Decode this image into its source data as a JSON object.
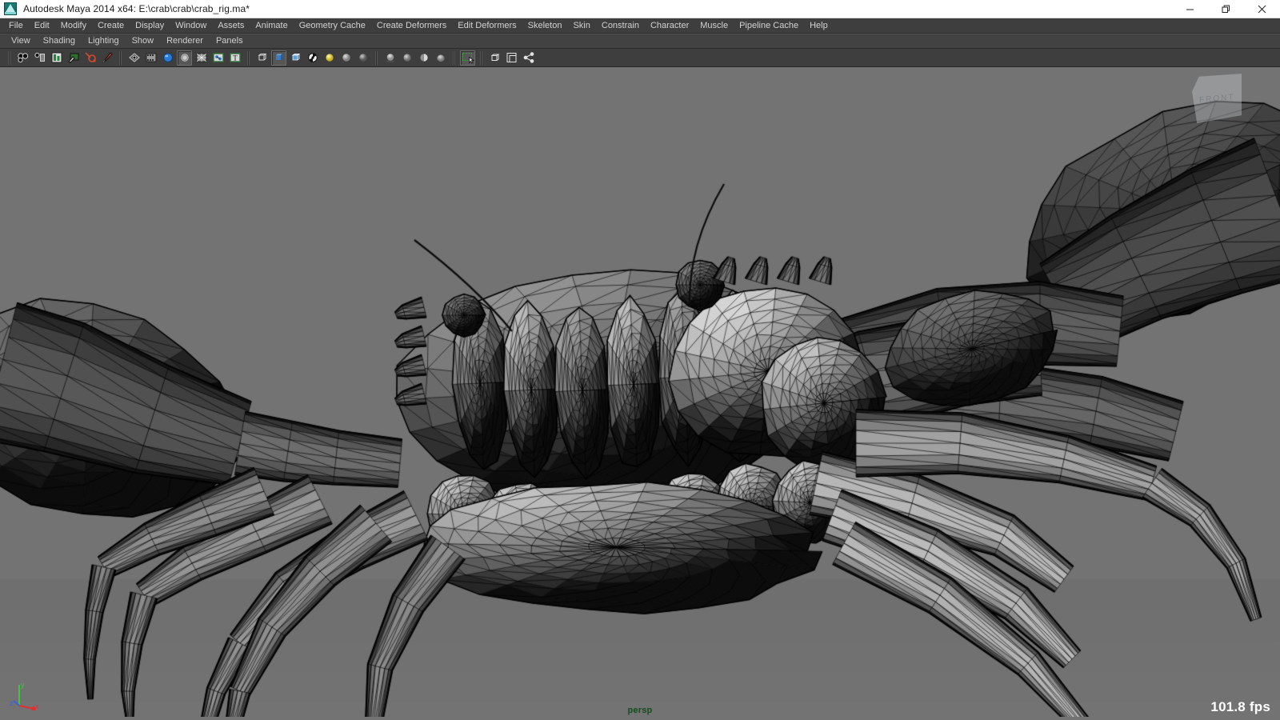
{
  "window": {
    "title": "Autodesk Maya 2014 x64: E:\\crab\\crab\\crab_rig.ma*",
    "app_icon": "maya-logo-icon",
    "controls": [
      {
        "name": "minimize",
        "glyph": "minimize-icon"
      },
      {
        "name": "restore",
        "glyph": "restore-icon"
      },
      {
        "name": "close",
        "glyph": "close-icon"
      }
    ]
  },
  "main_menu": {
    "items": [
      {
        "label": "File"
      },
      {
        "label": "Edit"
      },
      {
        "label": "Modify"
      },
      {
        "label": "Create"
      },
      {
        "label": "Display"
      },
      {
        "label": "Window"
      },
      {
        "label": "Assets"
      },
      {
        "label": "Animate"
      },
      {
        "label": "Geometry Cache"
      },
      {
        "label": "Create Deformers"
      },
      {
        "label": "Edit Deformers"
      },
      {
        "label": "Skeleton"
      },
      {
        "label": "Skin"
      },
      {
        "label": "Constrain"
      },
      {
        "label": "Character"
      },
      {
        "label": "Muscle"
      },
      {
        "label": "Pipeline Cache"
      },
      {
        "label": "Help"
      }
    ]
  },
  "panel_menu": {
    "items": [
      {
        "label": "View"
      },
      {
        "label": "Shading"
      },
      {
        "label": "Lighting"
      },
      {
        "label": "Show"
      },
      {
        "label": "Renderer"
      },
      {
        "label": "Panels"
      }
    ]
  },
  "toolbar": {
    "groups": [
      {
        "name": "selection-masks",
        "buttons": [
          {
            "name": "select-by-hierarchy-icon",
            "pressed": false
          },
          {
            "name": "select-by-object-type-icon",
            "pressed": false
          },
          {
            "name": "select-by-component-type-icon",
            "pressed": false
          },
          {
            "name": "paint-selection-icon",
            "pressed": false
          },
          {
            "name": "snap-to-point-icon",
            "pressed": false
          },
          {
            "name": "paint-brush-icon",
            "pressed": false
          }
        ]
      },
      {
        "name": "display-masks",
        "buttons": [
          {
            "name": "nurbs-surface-mask-icon",
            "pressed": false
          },
          {
            "name": "polygon-mask-icon",
            "pressed": false
          },
          {
            "name": "subdiv-surface-mask-icon",
            "pressed": false
          },
          {
            "name": "deformation-mask-icon",
            "pressed": true
          },
          {
            "name": "dynamics-mask-icon",
            "pressed": false
          },
          {
            "name": "rendering-mask-icon",
            "pressed": false
          },
          {
            "name": "text-mask-icon",
            "pressed": false
          }
        ]
      },
      {
        "name": "shading-modes",
        "buttons": [
          {
            "name": "wireframe-shading-icon",
            "pressed": false
          },
          {
            "name": "smooth-shade-all-icon",
            "pressed": true
          },
          {
            "name": "shaded-wireframe-icon",
            "pressed": false
          },
          {
            "name": "textured-shading-icon",
            "pressed": false
          },
          {
            "name": "use-default-light-icon",
            "pressed": false
          },
          {
            "name": "use-all-lights-icon",
            "pressed": false
          },
          {
            "name": "use-no-lights-icon",
            "pressed": false
          }
        ]
      },
      {
        "name": "lighting-shadows",
        "buttons": [
          {
            "name": "shadow-toggle-icon",
            "pressed": false
          },
          {
            "name": "occlusion-toggle-icon",
            "pressed": false
          },
          {
            "name": "motion-blur-icon",
            "pressed": false
          },
          {
            "name": "anti-alias-icon",
            "pressed": false
          }
        ]
      },
      {
        "name": "isolate-select",
        "buttons": [
          {
            "name": "isolate-select-icon",
            "pressed": true
          }
        ]
      },
      {
        "name": "panel-layout",
        "buttons": [
          {
            "name": "xray-mode-icon",
            "pressed": false
          },
          {
            "name": "xray-joints-icon",
            "pressed": false
          },
          {
            "name": "hypergraph-icon",
            "pressed": false
          }
        ]
      }
    ]
  },
  "viewport": {
    "camera_label": "persp",
    "fps_label": "101.8 fps",
    "background_color": "#737373",
    "viewcube_face": "FRONT",
    "axis_gizmo": {
      "x_label": "x",
      "y_label": "y",
      "z_label": "z",
      "x_color": "#e03030",
      "y_color": "#3fc43f",
      "z_color": "#3b5fe0"
    },
    "scene": {
      "name": "crab_rig",
      "display_mode": "smooth-shade-with-wireframe",
      "mesh_wire_color": "#000000",
      "mesh_fill_light": "#e8e8e8",
      "mesh_fill_dark": "#1a1a1a"
    }
  }
}
